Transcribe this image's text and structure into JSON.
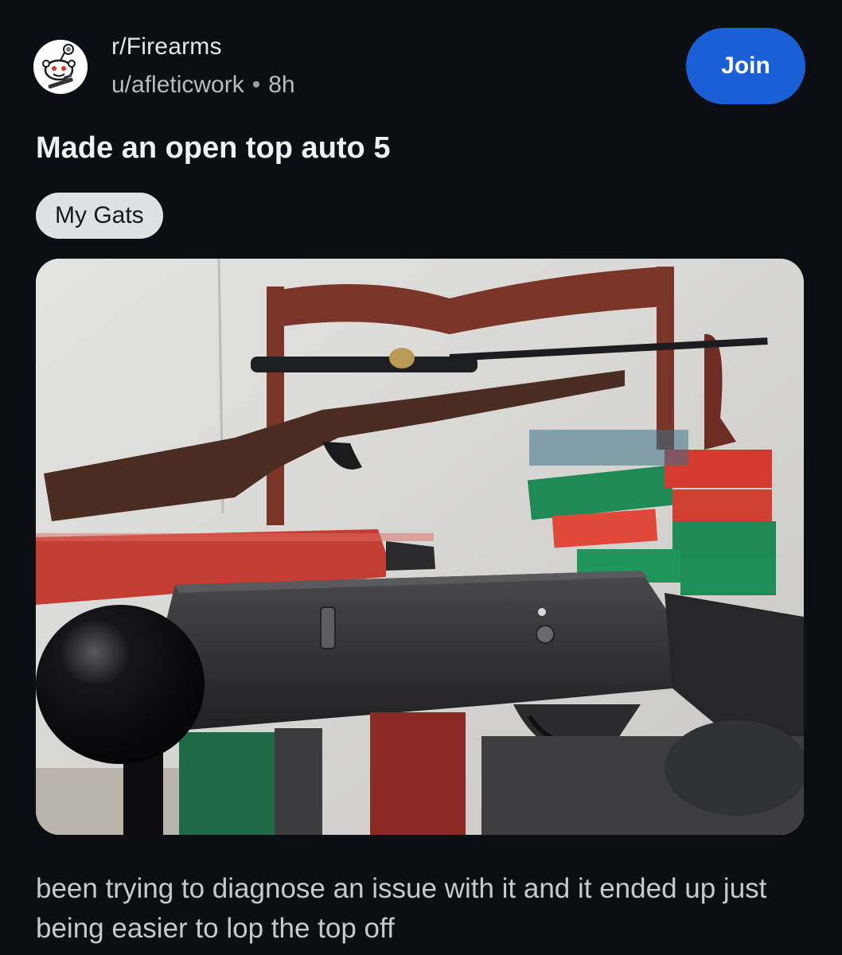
{
  "post": {
    "subreddit": "r/Firearms",
    "author": "u/afleticwork",
    "separator": "•",
    "age": "8h",
    "join_label": "Join",
    "title": "Made an open top auto 5",
    "flair": "My Gats",
    "body": "been trying to diagnose an issue with it and it ended up just being easier to lop the top off"
  },
  "icons": {
    "avatar": "snoo-avatar-icon"
  },
  "colors": {
    "background": "#0b0e12",
    "join_button": "#1a5fd6",
    "flair_bg": "#dfe1e3"
  }
}
